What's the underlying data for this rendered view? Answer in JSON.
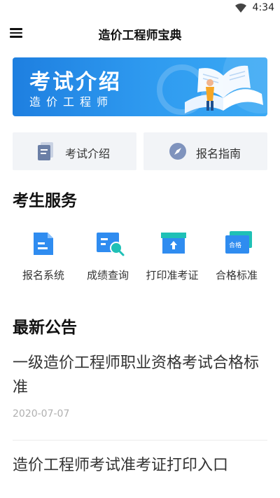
{
  "status_bar": {
    "time": "4:34"
  },
  "app_bar": {
    "title": "造价工程师宝典"
  },
  "banner": {
    "title": "考试介绍",
    "subtitle": "造价工程师"
  },
  "quick_links": [
    {
      "label": "考试介绍",
      "icon": "document-icon"
    },
    {
      "label": "报名指南",
      "icon": "compass-icon"
    }
  ],
  "services": {
    "heading": "考生服务",
    "items": [
      {
        "label": "报名系统",
        "icon": "file-icon"
      },
      {
        "label": "成绩查询",
        "icon": "search-icon"
      },
      {
        "label": "打印准考证",
        "icon": "print-icon"
      },
      {
        "label": "合格标准",
        "icon": "card-icon",
        "badge": "合格"
      }
    ]
  },
  "notices": {
    "heading": "最新公告",
    "items": [
      {
        "title": "一级造价工程师职业资格考试合格标准",
        "date": "2020-07-07"
      },
      {
        "title": "造价工程师考试准考证打印入口"
      }
    ]
  },
  "colors": {
    "primary": "#2f8cf0",
    "accent": "#1fc0b6",
    "banner": "#2a94ee"
  }
}
